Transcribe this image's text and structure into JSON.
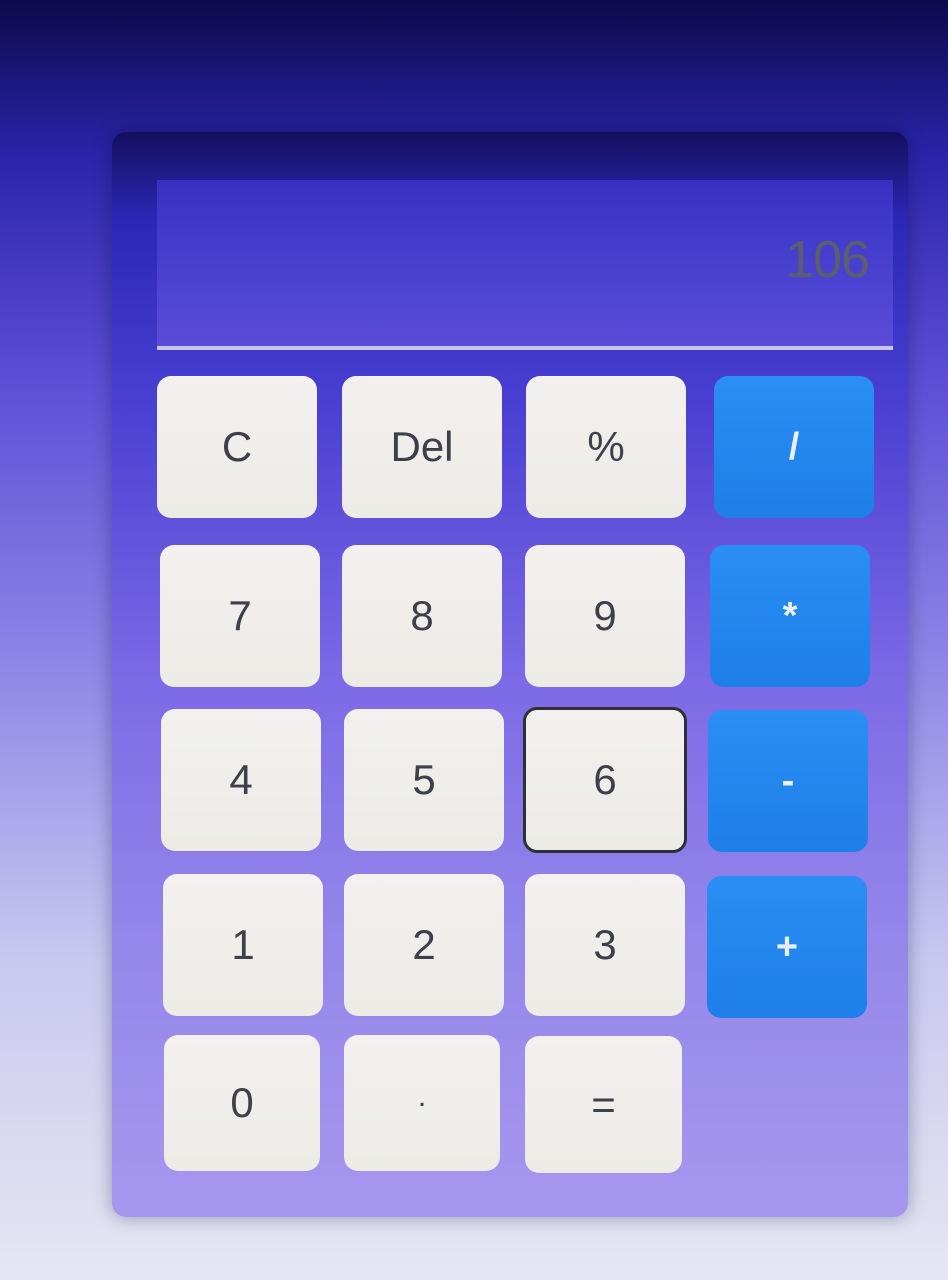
{
  "display": {
    "value": "106"
  },
  "keys": {
    "clear": "C",
    "delete": "Del",
    "percent": "%",
    "divide": "/",
    "seven": "7",
    "eight": "8",
    "nine": "9",
    "multiply": "*",
    "four": "4",
    "five": "5",
    "six": "6",
    "subtract": "-",
    "one": "1",
    "two": "2",
    "three": "3",
    "add": "+",
    "zero": "0",
    "decimal": ".",
    "equals": "="
  },
  "colors": {
    "operator_key": "#1d7fe7",
    "number_key": "#eeede9",
    "display_text": "#5b5f6c"
  }
}
